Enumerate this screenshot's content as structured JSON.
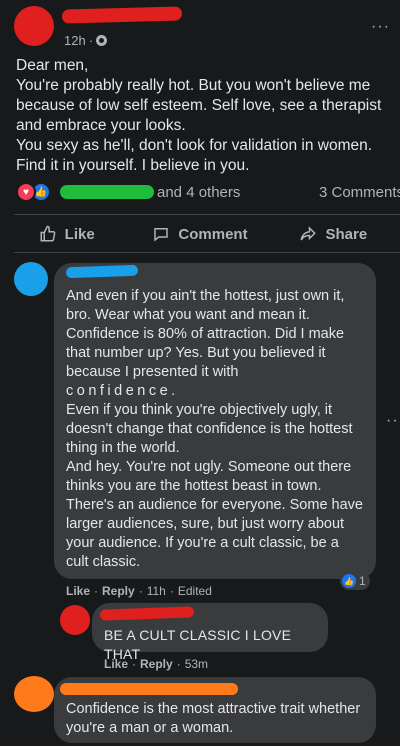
{
  "post": {
    "time": "12h",
    "more": "···",
    "body": [
      "Dear men,",
      "You're probably really hot. But you won't believe me because of low self esteem. Self love, see a therapist and embrace your looks.",
      "You sexy as he'll, don't look for validation in women. Find it in yourself. I believe in you."
    ]
  },
  "reactions": {
    "others": "and 4 others",
    "comments": "3 Comments"
  },
  "actions": {
    "like": "Like",
    "comment": "Comment",
    "share": "Share"
  },
  "comments": [
    {
      "paragraphs": [
        "And even if you ain't the hottest, just own it, bro. Wear what you want and mean it. Confidence is 80% of attraction. Did I make that number up? Yes. But you believed it because I presented it with",
        "confidence.",
        "Even if you think you're objectively ugly, it doesn't change that confidence is the hottest thing in the world.",
        "And hey. You're not ugly. Someone out there thinks you are the hottest beast in town. There's an audience for everyone. Some have larger audiences, sure, but just worry about your audience. If you're a cult classic, be a cult classic."
      ],
      "like": "Like",
      "reply": "Reply",
      "time": "11h",
      "edited": "Edited",
      "reaction_count": "1"
    },
    {
      "text": "BE A CULT CLASSIC I LOVE THAT",
      "like": "Like",
      "reply": "Reply",
      "time": "53m"
    },
    {
      "text": "Confidence is the most attractive trait whether you're a man or a woman."
    }
  ],
  "sep": "·",
  "colors": {
    "background": "#18191a",
    "bubble": "#3a3b3c",
    "text": "#e4e6eb",
    "muted": "#b0b3b8",
    "like_blue": "#1877f2",
    "love_red": "#f33e58"
  }
}
